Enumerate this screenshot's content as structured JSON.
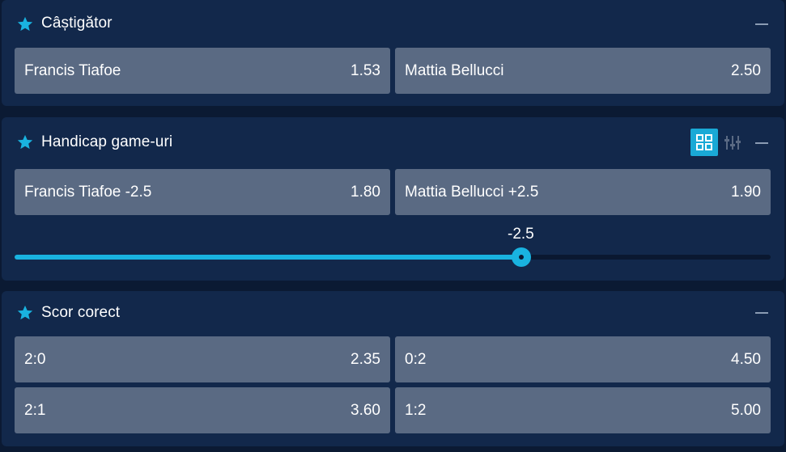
{
  "colors": {
    "background": "#0b1a33",
    "panel": "#12284b",
    "odd_button": "#5a6a83",
    "accent": "#19b3e0"
  },
  "winner": {
    "title": "Câștigător",
    "star_icon": "star-icon",
    "collapse_icon": "minus-icon",
    "options": [
      {
        "label": "Francis Tiafoe",
        "odds": "1.53"
      },
      {
        "label": "Mattia Bellucci",
        "odds": "2.50"
      }
    ]
  },
  "handicap": {
    "title": "Handicap game-uri",
    "star_icon": "star-icon",
    "grid_view_icon": "grid-icon",
    "list_view_icon": "list-sliders-icon",
    "collapse_icon": "minus-icon",
    "options": [
      {
        "label": "Francis Tiafoe -2.5",
        "odds": "1.80"
      },
      {
        "label": "Mattia Bellucci +2.5",
        "odds": "1.90"
      }
    ],
    "slider": {
      "value_label": "-2.5",
      "position_fraction": 0.67
    }
  },
  "correct_score": {
    "title": "Scor corect",
    "star_icon": "star-icon",
    "collapse_icon": "minus-icon",
    "options": [
      {
        "label": "2:0",
        "odds": "2.35"
      },
      {
        "label": "0:2",
        "odds": "4.50"
      },
      {
        "label": "2:1",
        "odds": "3.60"
      },
      {
        "label": "1:2",
        "odds": "5.00"
      }
    ]
  }
}
